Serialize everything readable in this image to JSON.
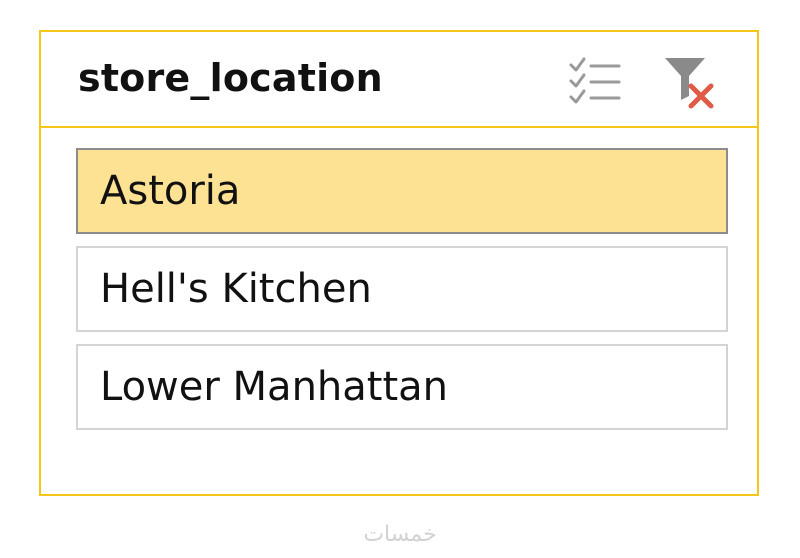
{
  "slicer": {
    "title": "store_location",
    "icons": {
      "multi_select": "multi-select-icon",
      "clear_filter": "clear-filter-icon"
    },
    "items": [
      {
        "label": "Astoria",
        "selected": true
      },
      {
        "label": "Hell's Kitchen",
        "selected": false
      },
      {
        "label": "Lower Manhattan",
        "selected": false
      }
    ],
    "colors": {
      "border": "#f5c518",
      "selected_fill": "#fde293",
      "clear_x": "#e05a47"
    }
  },
  "watermark": "خمسات"
}
